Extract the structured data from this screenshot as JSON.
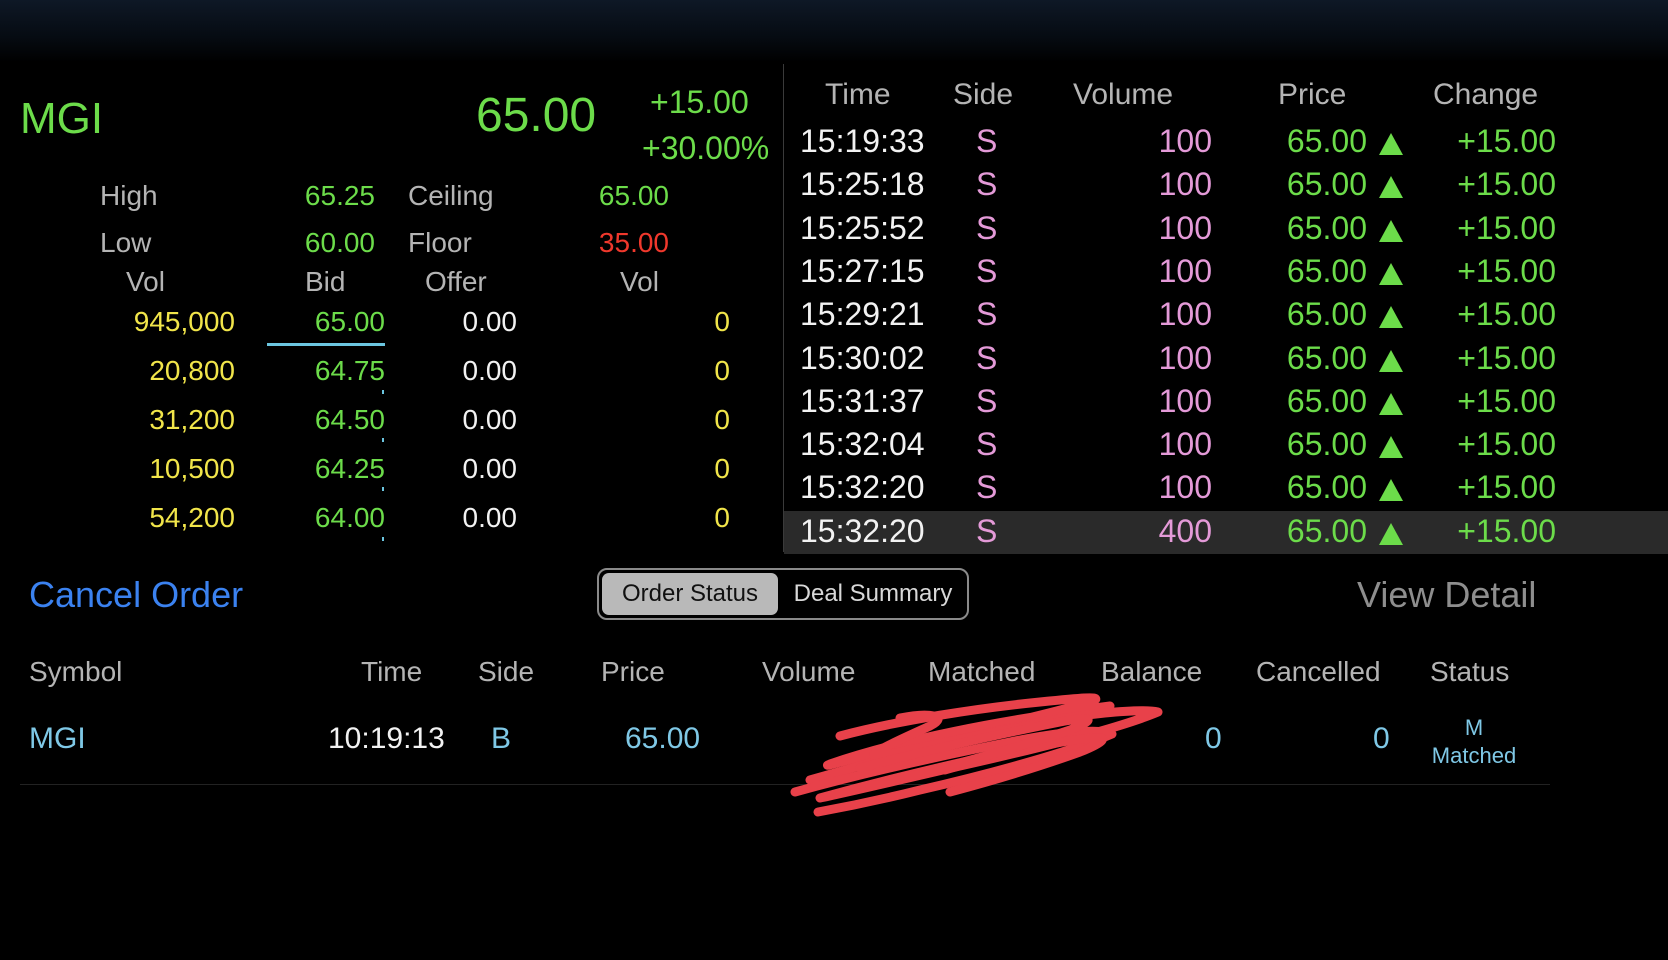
{
  "quote": {
    "symbol": "MGI",
    "last_price": "65.00",
    "change_abs": "+15.00",
    "change_pct": "+30.00%",
    "high_label": "High",
    "high_value": "65.25",
    "low_label": "Low",
    "low_value": "60.00",
    "ceiling_label": "Ceiling",
    "ceiling_value": "65.00",
    "floor_label": "Floor",
    "floor_value": "35.00"
  },
  "order_book": {
    "headers": {
      "bid_vol": "Vol",
      "bid": "Bid",
      "offer": "Offer",
      "offer_vol": "Vol"
    },
    "rows": [
      {
        "bid_vol": "945,000",
        "bid": "65.00",
        "offer": "0.00",
        "offer_vol": "0"
      },
      {
        "bid_vol": "20,800",
        "bid": "64.75",
        "offer": "0.00",
        "offer_vol": "0"
      },
      {
        "bid_vol": "31,200",
        "bid": "64.50",
        "offer": "0.00",
        "offer_vol": "0"
      },
      {
        "bid_vol": "10,500",
        "bid": "64.25",
        "offer": "0.00",
        "offer_vol": "0"
      },
      {
        "bid_vol": "54,200",
        "bid": "64.00",
        "offer": "0.00",
        "offer_vol": "0"
      }
    ]
  },
  "trade_log": {
    "headers": {
      "time": "Time",
      "side": "Side",
      "volume": "Volume",
      "price": "Price",
      "change": "Change"
    },
    "rows": [
      {
        "time": "15:19:33",
        "side": "S",
        "volume": "100",
        "price": "65.00",
        "change": "+15.00"
      },
      {
        "time": "15:25:18",
        "side": "S",
        "volume": "100",
        "price": "65.00",
        "change": "+15.00"
      },
      {
        "time": "15:25:52",
        "side": "S",
        "volume": "100",
        "price": "65.00",
        "change": "+15.00"
      },
      {
        "time": "15:27:15",
        "side": "S",
        "volume": "100",
        "price": "65.00",
        "change": "+15.00"
      },
      {
        "time": "15:29:21",
        "side": "S",
        "volume": "100",
        "price": "65.00",
        "change": "+15.00"
      },
      {
        "time": "15:30:02",
        "side": "S",
        "volume": "100",
        "price": "65.00",
        "change": "+15.00"
      },
      {
        "time": "15:31:37",
        "side": "S",
        "volume": "100",
        "price": "65.00",
        "change": "+15.00"
      },
      {
        "time": "15:32:04",
        "side": "S",
        "volume": "100",
        "price": "65.00",
        "change": "+15.00"
      },
      {
        "time": "15:32:20",
        "side": "S",
        "volume": "100",
        "price": "65.00",
        "change": "+15.00"
      },
      {
        "time": "15:32:20",
        "side": "S",
        "volume": "400",
        "price": "65.00",
        "change": "+15.00"
      }
    ],
    "up_icon": "triangle-up-icon"
  },
  "orders": {
    "cancel_label": "Cancel Order",
    "tabs": [
      "Order Status",
      "Deal Summary"
    ],
    "selected_tab": "Order Status",
    "view_detail_label": "View Detail",
    "headers": {
      "symbol": "Symbol",
      "time": "Time",
      "side": "Side",
      "price": "Price",
      "volume": "Volume",
      "matched": "Matched",
      "balance": "Balance",
      "cancelled": "Cancelled",
      "status": "Status"
    },
    "row": {
      "symbol": "MGI",
      "time": "10:19:13",
      "side": "B",
      "price": "65.00",
      "balance": "0",
      "cancelled": "0",
      "status_code": "M",
      "status_text": "Matched"
    }
  },
  "colors": {
    "up": "#6cdc4a",
    "volume": "#f1e54a",
    "floor": "#f0382c",
    "sell": "#e49ad8",
    "link": "#3b82f0",
    "order_text": "#7fc8e6",
    "redaction": "#e8414a"
  }
}
